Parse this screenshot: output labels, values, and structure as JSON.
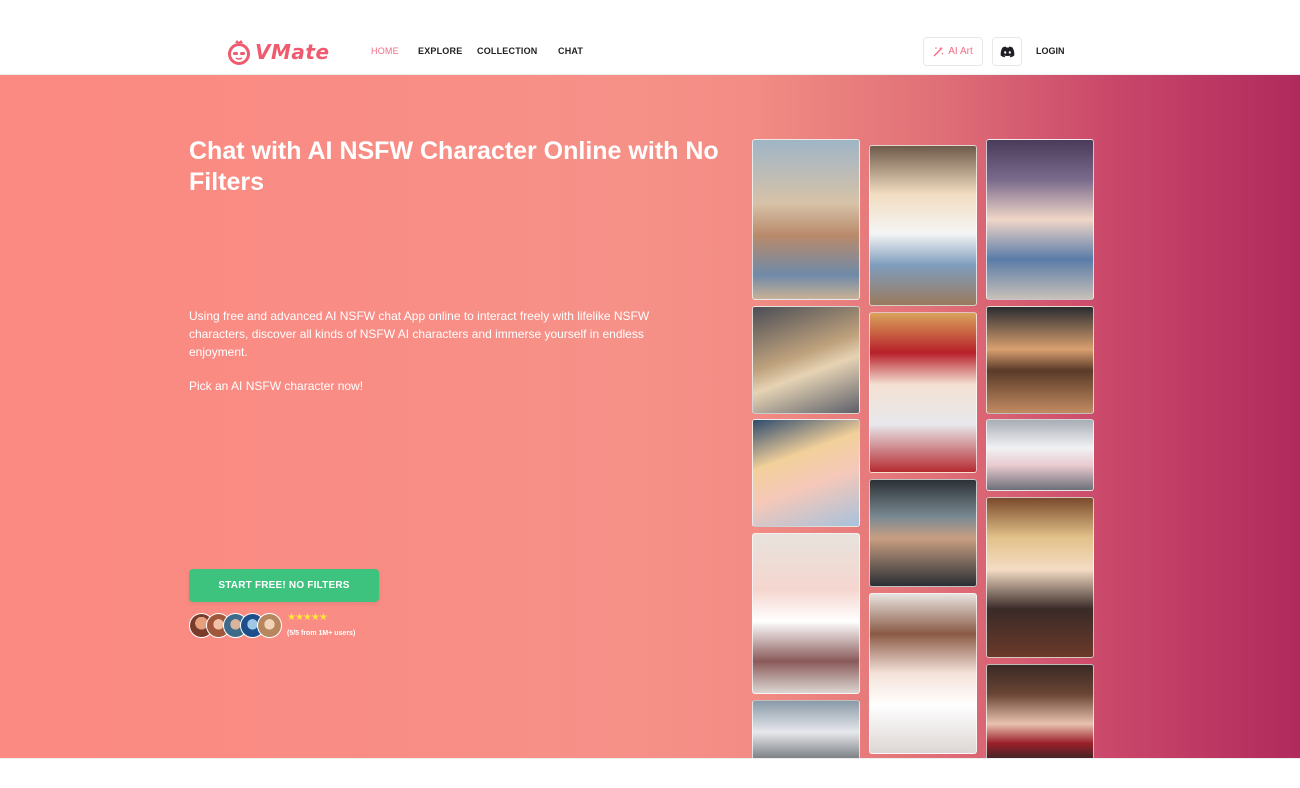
{
  "brand": {
    "name": "VMate",
    "color": "#f05a6e"
  },
  "nav": {
    "items": [
      "HOME",
      "EXPLORE",
      "COLLECTION",
      "CHAT"
    ],
    "active": "HOME"
  },
  "header_actions": {
    "ai_art_label": "AI Art",
    "discord_icon": "discord-icon",
    "login_label": "LOGIN"
  },
  "hero": {
    "title": "Chat with AI NSFW Character Online with No Filters",
    "description": "Using free and advanced AI NSFW chat App online to interact freely with lifelike NSFW characters, discover all kinds of NSFW AI characters and immerse yourself in endless enjoyment.",
    "cta_text": "Pick an AI NSFW character now!",
    "start_button": "START FREE! NO FILTERS",
    "stars": "★★★★★",
    "rating": "(5/5 from 1M+ users)",
    "start_button_color": "#3ec37f"
  },
  "gallery": {
    "columns": [
      [
        "character-card",
        "character-card",
        "character-card",
        "character-card",
        "character-card"
      ],
      [
        "character-card",
        "character-card",
        "character-card",
        "character-card"
      ],
      [
        "character-card",
        "character-card",
        "character-card",
        "character-card",
        "character-card"
      ]
    ]
  }
}
